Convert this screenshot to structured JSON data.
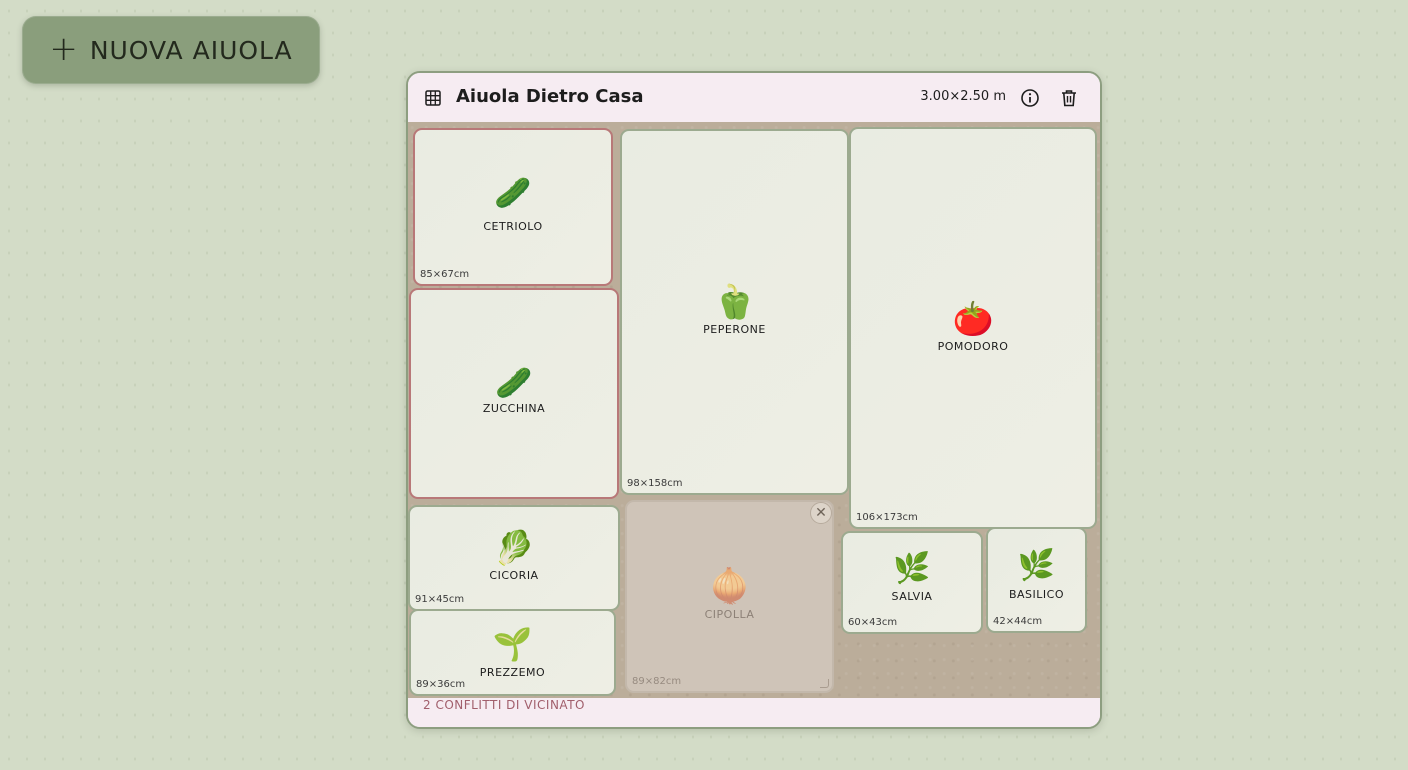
{
  "new_bed_button": {
    "icon": "plus-icon",
    "label": "NUOVA AIUOLA"
  },
  "bed": {
    "title": "Aiuola Dietro Casa",
    "dimensions": "3.00×2.50 m",
    "conflicts_text": "2 CONFLITTI DI VICINATO",
    "icons": {
      "grid": "grid-icon",
      "info": "info-icon",
      "trash": "trash-icon"
    },
    "plants": [
      {
        "emoji": "🥒",
        "name": "CETRIOLO",
        "size": "85×67cm",
        "conflict": true
      },
      {
        "emoji": "🫑",
        "name": "PEPERONE",
        "size": "98×158cm",
        "conflict": false
      },
      {
        "emoji": "🍅",
        "name": "POMODORO",
        "size": "106×173cm",
        "conflict": false
      },
      {
        "emoji": "🥒",
        "name": "ZUCCHINA",
        "size": "",
        "conflict": true
      },
      {
        "emoji": "🥬",
        "name": "CICORIA",
        "size": "91×45cm",
        "conflict": false
      },
      {
        "emoji": "🧅",
        "name": "CIPOLLA",
        "size": "89×82cm",
        "conflict": false,
        "selected": true
      },
      {
        "emoji": "🌿",
        "name": "SALVIA",
        "size": "60×43cm",
        "conflict": false
      },
      {
        "emoji": "🌿",
        "name": "BASILICO",
        "size": "42×44cm",
        "conflict": false
      },
      {
        "emoji": "🌱",
        "name": "PREZZEMO",
        "size": "89×36cm",
        "conflict": false
      }
    ]
  }
}
